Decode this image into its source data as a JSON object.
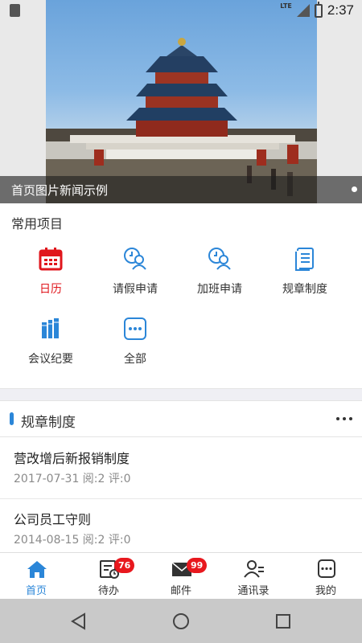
{
  "status_bar": {
    "network": "LTE",
    "time": "2:37"
  },
  "banner": {
    "caption": "首页图片新闻示例"
  },
  "common": {
    "title": "常用项目",
    "items": [
      {
        "label": "日历",
        "icon": "calendar-icon",
        "active": true
      },
      {
        "label": "请假申请",
        "icon": "leave-request-icon",
        "active": false
      },
      {
        "label": "加班申请",
        "icon": "overtime-request-icon",
        "active": false
      },
      {
        "label": "规章制度",
        "icon": "document-icon",
        "active": false
      },
      {
        "label": "会议纪要",
        "icon": "books-icon",
        "active": false
      },
      {
        "label": "全部",
        "icon": "more-icon",
        "active": false
      }
    ]
  },
  "rules": {
    "title": "规章制度",
    "articles": [
      {
        "title": "营改增后新报销制度",
        "meta": "2017-07-31 阅:2 评:0"
      },
      {
        "title": "公司员工守则",
        "meta": "2014-08-15 阅:2 评:0"
      }
    ]
  },
  "tabs": [
    {
      "label": "首页",
      "icon": "home-icon",
      "active": true,
      "badge": null
    },
    {
      "label": "待办",
      "icon": "todo-icon",
      "active": false,
      "badge": "76"
    },
    {
      "label": "邮件",
      "icon": "mail-icon",
      "active": false,
      "badge": "99"
    },
    {
      "label": "通讯录",
      "icon": "contacts-icon",
      "active": false,
      "badge": null
    },
    {
      "label": "我的",
      "icon": "profile-icon",
      "active": false,
      "badge": null
    }
  ],
  "colors": {
    "accent": "#2b86d8",
    "calendar_red": "#e0161c",
    "badge_red": "#e8181e"
  }
}
